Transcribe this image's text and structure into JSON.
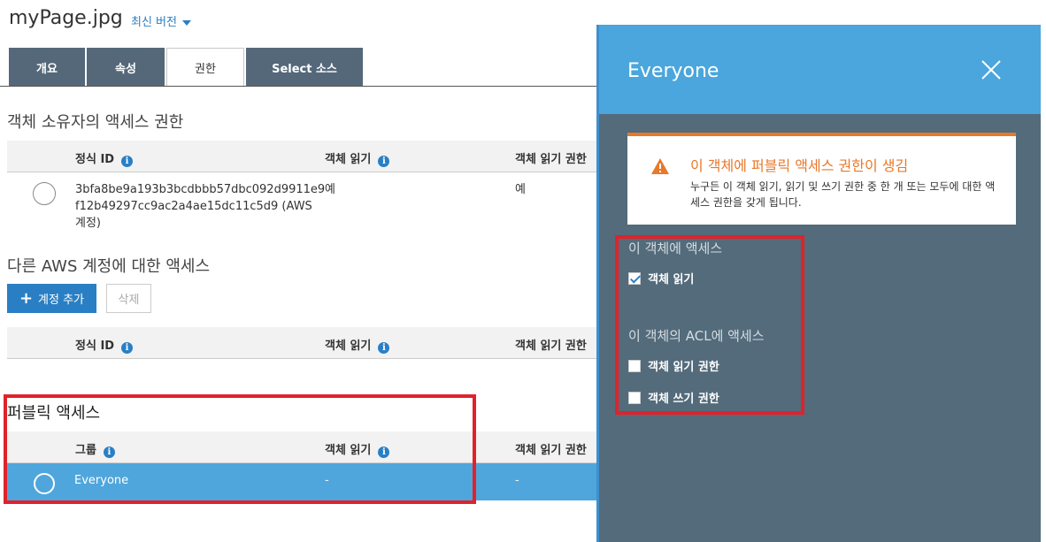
{
  "header": {
    "file_name": "myPage.jpg",
    "version_label": "최신 버전"
  },
  "tabs": [
    {
      "label": "개요"
    },
    {
      "label": "속성"
    },
    {
      "label": "권한"
    },
    {
      "label": "Select 소스"
    }
  ],
  "owner_section": {
    "title": "객체 소유자의 액세스 권한",
    "columns": [
      "정식 ID",
      "객체 읽기",
      "객체 읽기 권한"
    ],
    "row": {
      "id_line1": "3bfa8be9a193b3bcdbbb57dbc092d9911e9",
      "id_line2": "f12b49297cc9ac2a4ae15dc11c5d9 (AWS",
      "id_line3": "계정)",
      "read": "예",
      "read_acl": "예"
    }
  },
  "other_accounts": {
    "title": "다른 AWS 계정에 대한 액세스",
    "add_button": "계정 추가",
    "delete_button": "삭제",
    "columns": [
      "정식 ID",
      "객체 읽기",
      "객체 읽기 권한"
    ]
  },
  "public_access": {
    "title": "퍼블릭 액세스",
    "columns": [
      "그룹",
      "객체 읽기",
      "객체 읽기 권한"
    ],
    "row": {
      "group": "Everyone",
      "read": "-",
      "read_acl": "-"
    }
  },
  "panel": {
    "title": "Everyone",
    "warning_title": "이 객체에 퍼블릭 액세스 권한이 생김",
    "warning_text": "누구든 이 객체 읽기, 읽기 및 쓰기 권한 중 한 개 또는 모두에 대한 액세스 권한을 갖게 됩니다.",
    "object_access_label": "이 객체에 액세스",
    "read_object": "객체 읽기",
    "acl_access_label": "이 객체의 ACL에 액세스",
    "read_acl": "객체 읽기 권한",
    "write_acl": "객체 쓰기 권한"
  },
  "colors": {
    "tab_bg": "#54687a",
    "accent_blue": "#2a7fc4",
    "selected_row": "#4fa6dc",
    "panel_bg": "#536b7b",
    "panel_header": "#4aa6dc",
    "warning_orange": "#e8782a",
    "highlight_red": "#e0222a"
  }
}
